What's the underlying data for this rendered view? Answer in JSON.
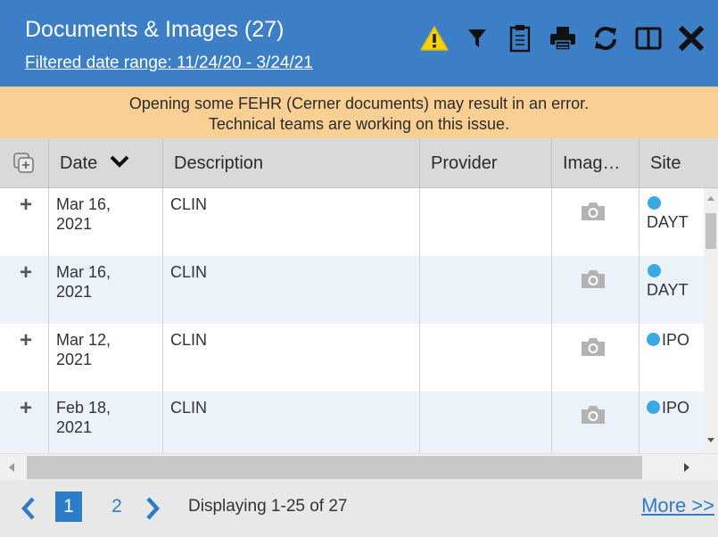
{
  "header": {
    "title": "Documents & Images (27)",
    "subtitle": "Filtered date range: 11/24/20 - 3/24/21",
    "toolbar_icons": [
      "warning-icon",
      "filter-icon",
      "clipboard-icon",
      "print-icon",
      "refresh-icon",
      "split-view-icon",
      "close-icon"
    ],
    "bg_color": "#3d7fc7"
  },
  "banner": {
    "line1": "Opening some FEHR (Cerner documents) may result in an error.",
    "line2": "Technical teams are working on this issue.",
    "bg_color": "#f9cf93"
  },
  "table": {
    "columns": [
      "Date",
      "Description",
      "Provider",
      "Imag…",
      "Site"
    ],
    "rows": [
      {
        "date_line1": "Mar 16,",
        "date_line2": "2021",
        "description": "CLIN",
        "provider": "",
        "site": "DAYT"
      },
      {
        "date_line1": "Mar 16,",
        "date_line2": "2021",
        "description": "CLIN",
        "provider": "",
        "site": "DAYT"
      },
      {
        "date_line1": "Mar 12,",
        "date_line2": "2021",
        "description": "CLIN",
        "provider": "",
        "site": "IPO"
      },
      {
        "date_line1": "Feb 18,",
        "date_line2": "2021",
        "description": "CLIN",
        "provider": "",
        "site": "IPO"
      }
    ],
    "expand_symbol": "+",
    "site_dot_color": "#3aa8e4",
    "alt_row_color": "#ebf2fa"
  },
  "footer": {
    "pages": [
      "1",
      "2"
    ],
    "active_page": "1",
    "status": "Displaying 1-25 of 27",
    "more_link": "More >>",
    "accent_color": "#2e7bc7"
  }
}
